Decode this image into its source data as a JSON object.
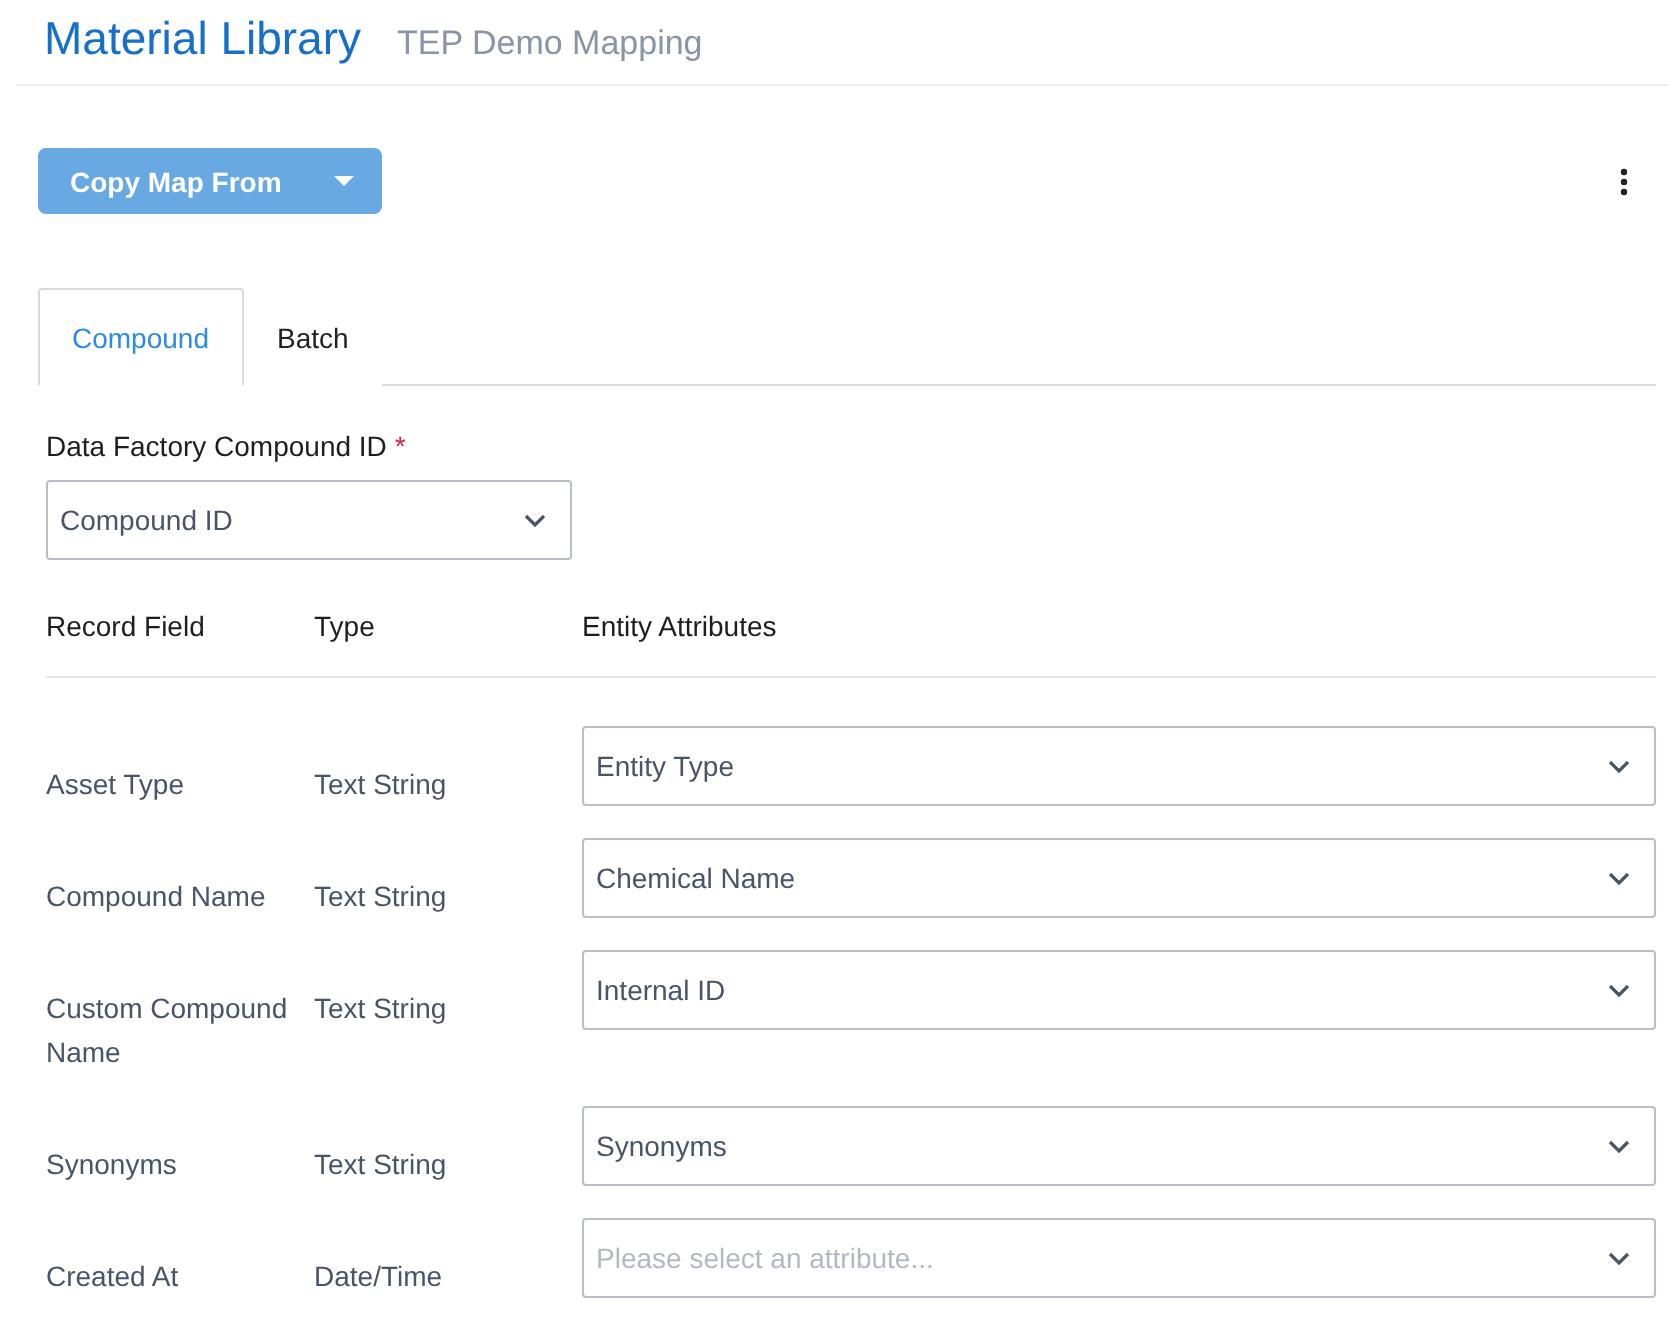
{
  "header": {
    "title": "Material Library",
    "subtitle": "TEP Demo Mapping"
  },
  "copy_button": {
    "label": "Copy Map From"
  },
  "tabs": [
    {
      "label": "Compound",
      "selected": true
    },
    {
      "label": "Batch",
      "selected": false
    }
  ],
  "id_field": {
    "label": "Data Factory Compound ID",
    "required_mark": "*",
    "value": "Compound ID"
  },
  "table": {
    "columns": [
      "Record Field",
      "Type",
      "Entity Attributes"
    ],
    "rows": [
      {
        "field": "Asset Type",
        "type": "Text String",
        "attribute": {
          "value": "Entity Type"
        }
      },
      {
        "field": "Compound Name",
        "type": "Text String",
        "attribute": {
          "value": "Chemical Name"
        }
      },
      {
        "field": "Custom Compound Name",
        "type": "Text String",
        "attribute": {
          "value": "Internal ID"
        }
      },
      {
        "field": "Synonyms",
        "type": "Text String",
        "attribute": {
          "value": "Synonyms"
        }
      },
      {
        "field": "Created At",
        "type": "Date/Time",
        "attribute": {
          "placeholder": "Please select an attribute..."
        }
      }
    ]
  }
}
